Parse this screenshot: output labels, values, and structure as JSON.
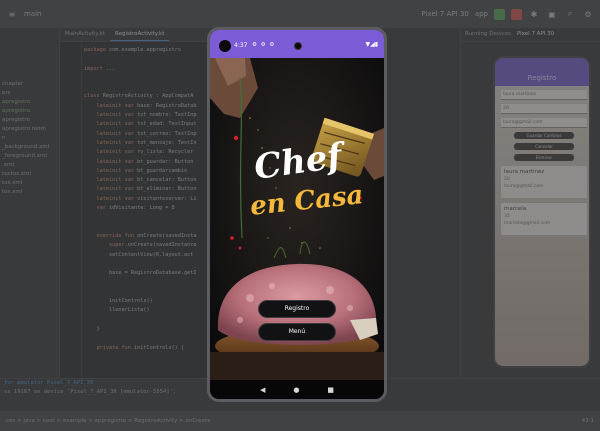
{
  "toolbar": {
    "left_label": "main",
    "device_selector": "Pixel 7 API 30",
    "app_selector": "app"
  },
  "project_tree": {
    "items": [
      {
        "label": "chapter",
        "highlight": false
      },
      {
        "label": "ers",
        "highlight": false
      },
      {
        "label": "apregistro",
        "highlight": true
      },
      {
        "label": "apregistro",
        "highlight": true
      },
      {
        "label": "apregistro",
        "highlight": false
      },
      {
        "label": "apregistro.room",
        "highlight": false
      },
      {
        "label": "n",
        "highlight": false
      },
      {
        "label": "_background.xml",
        "highlight": false
      },
      {
        "label": "_foreground.xml",
        "highlight": false
      },
      {
        "label": ".xml",
        "highlight": false
      },
      {
        "label": "ructos.xml",
        "highlight": false
      },
      {
        "label": "tos.xml",
        "highlight": false
      },
      {
        "label": "tos.xml",
        "highlight": false
      }
    ]
  },
  "editor": {
    "tabs": [
      {
        "label": "MainActivity.kt",
        "active": false
      },
      {
        "label": "RegistroActivity.kt",
        "active": true
      }
    ],
    "lines": [
      "package com.example.appregistro",
      "",
      "import ...",
      "",
      "",
      "class RegistroActivity : AppCompatA",
      "    lateinit var base: RegistroDatab",
      "    lateinit var txt_nombre: TextInp",
      "    lateinit var txt_edad: TextInput",
      "    lateinit var txt_correo: TextInp",
      "    lateinit var txt_mensaje: TextIn",
      "    lateinit var rv_lista: Recycler",
      "    lateinit var bt_guardar: Button",
      "    lateinit var bt_guardarcambio",
      "    lateinit var bt_cancelar: Button",
      "    lateinit var bt_eliminar: Button",
      "    lateinit var visitanteserver: Li",
      "    var idVisitante: Long = 0",
      "",
      "",
      "    override fun onCreate(savedInsta",
      "        super.onCreate(savedInstance",
      "        setContentView(R.layout.act",
      "",
      "        base = RegistroDatabase.getI",
      "",
      "",
      "        initControls()",
      "        llenarLista()",
      "",
      "    }",
      "",
      "    private fun initControls() {"
    ]
  },
  "run_panel": {
    "lines": [
      "for emulator Pixel_7_API_30",
      "ss 19167 on device 'Pixel_7_API_30 [emulator-5554]'."
    ]
  },
  "statusbar": {
    "breadcrumb": "ces > java > com > example > appregistro > RegistroActivity > onCreate",
    "position": "43:1"
  },
  "devices_pane": {
    "tabs": [
      {
        "label": "Running Devices",
        "active": false
      },
      {
        "label": "Pixel 7 API 30",
        "active": true
      }
    ],
    "mini_app": {
      "title": "Registro",
      "fields": [
        "laura martinez",
        "20",
        "laura@gmail.com"
      ],
      "buttons": [
        "Guardar Cambios",
        "Cancelar",
        "Eliminar"
      ],
      "cards": [
        {
          "name": "laura martinez",
          "line2": "20",
          "line3": "laura@gmail.com"
        },
        {
          "name": "marcela",
          "line2": "35",
          "line3": "marcela@gmail.com"
        }
      ]
    }
  },
  "phone": {
    "status_time": "4:37",
    "status_icons": "⚙ ⚙ ⚙",
    "status_right": "▼◢▮",
    "title_line1": "Chef",
    "title_line2": "en Casa",
    "buttons": {
      "registro": "Registro",
      "menu": "Menú"
    },
    "nav": {
      "back": "◀",
      "home": "●",
      "recents": "■"
    },
    "colors": {
      "status_bar": "#7c5cd6",
      "title_primary": "#ffffff",
      "title_accent": "#f4b93a"
    }
  }
}
